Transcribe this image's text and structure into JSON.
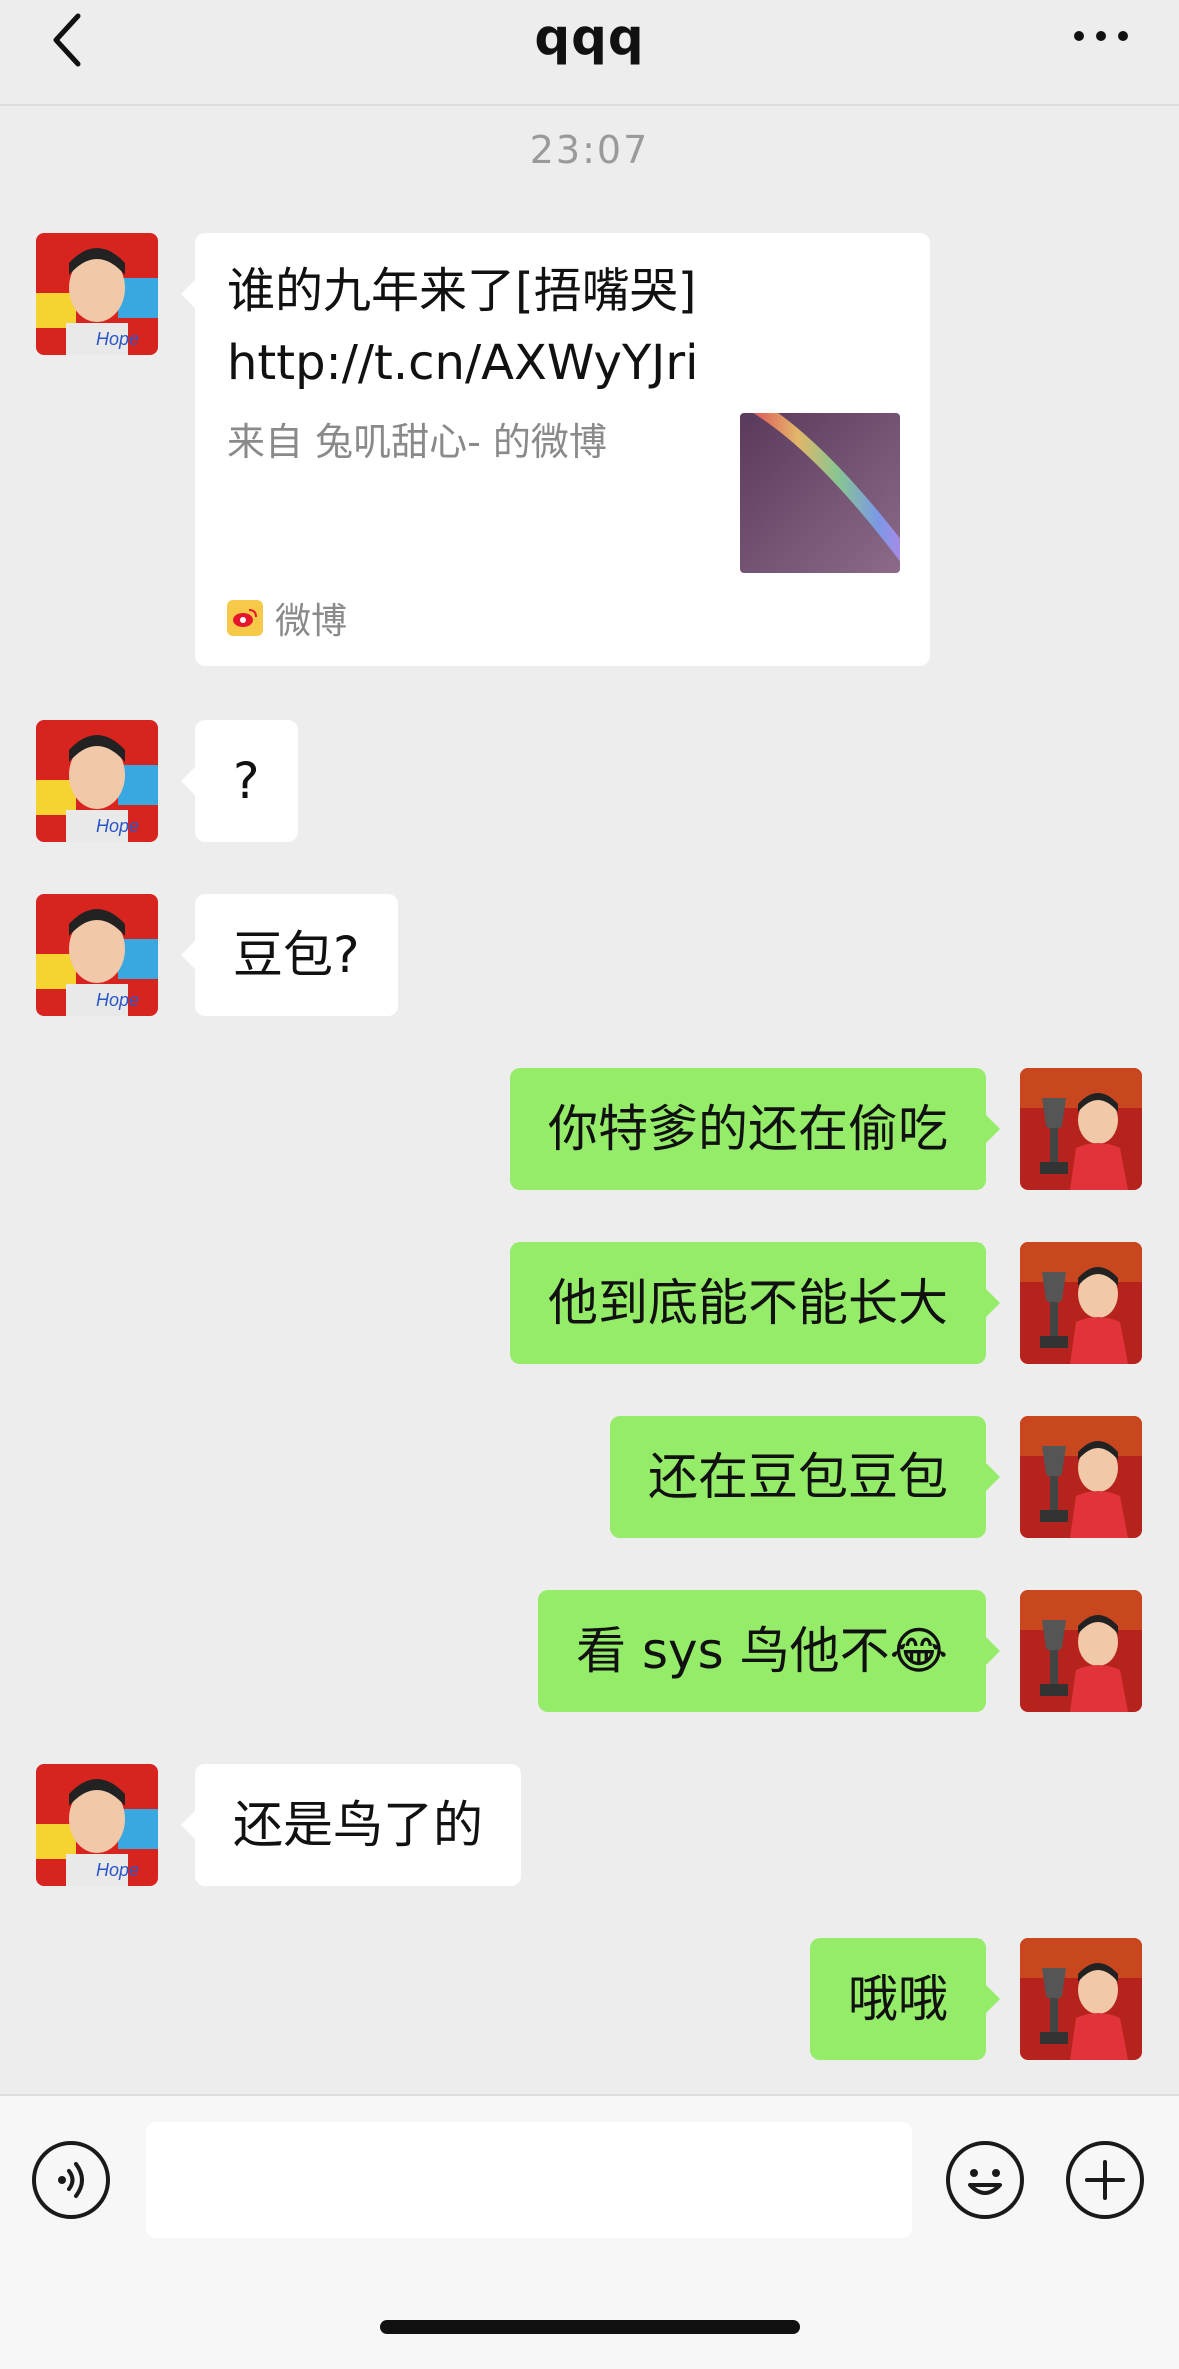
{
  "header": {
    "title": "qqq",
    "back_icon": "chevron-left-icon",
    "more_icon": "more-dots-icon"
  },
  "timestamp": "23:07",
  "link_card": {
    "title": "谁的九年来了[捂嘴哭] http://t.cn/AXWyYJri",
    "description": "来自 兔叽甜心- 的微博",
    "source": "微博"
  },
  "messages": [
    {
      "side": "in",
      "text": "?"
    },
    {
      "side": "in",
      "text": "豆包?"
    },
    {
      "side": "out",
      "text": "你特爹的还在偷吃"
    },
    {
      "side": "out",
      "text": "他到底能不能长大"
    },
    {
      "side": "out",
      "text": "还在豆包豆包"
    },
    {
      "side": "out",
      "text": "看 sys 鸟他不😂"
    },
    {
      "side": "in",
      "text": "还是鸟了的"
    },
    {
      "side": "out",
      "text": "哦哦"
    }
  ],
  "input_bar": {
    "input_value": "",
    "voice_icon": "voice-icon",
    "emoji_icon": "emoji-icon",
    "plus_icon": "plus-icon"
  },
  "colors": {
    "background": "#ededed",
    "incoming_bubble": "#ffffff",
    "outgoing_bubble": "#95ec69"
  }
}
